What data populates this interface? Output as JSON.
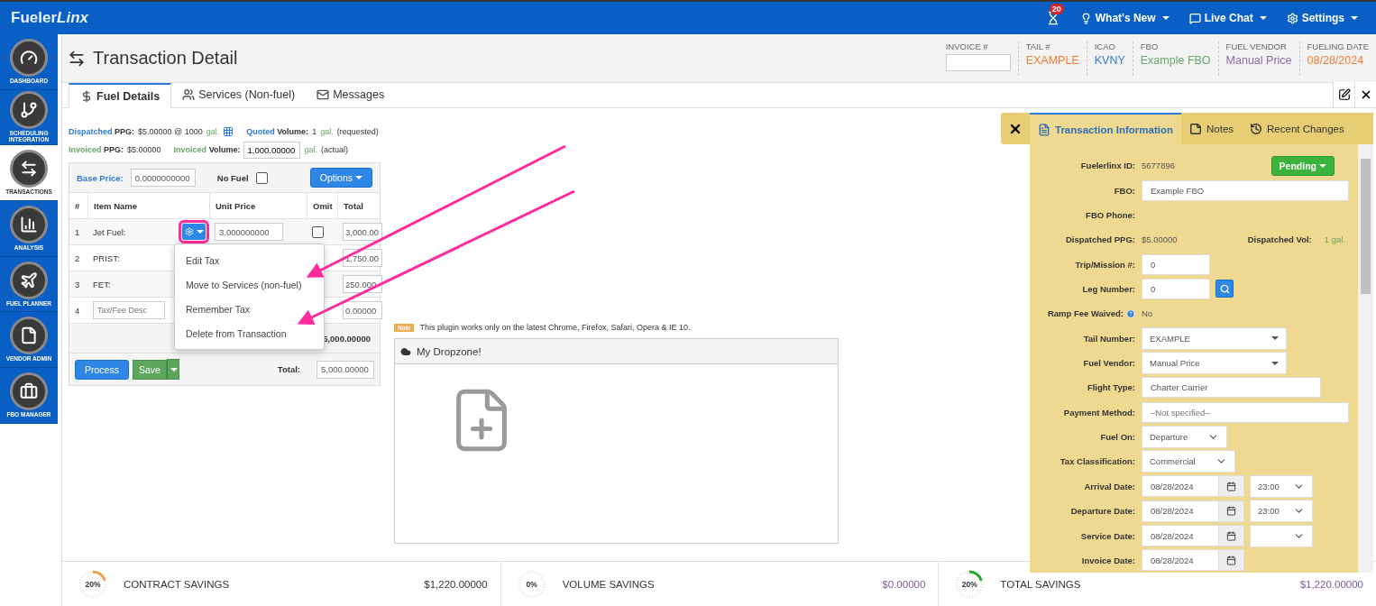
{
  "topbar": {
    "logo_main": "Fueler",
    "logo_accent": "Linx",
    "notification_count": "20",
    "menus": [
      {
        "kind": "bulb",
        "label": "What's New"
      },
      {
        "kind": "chat",
        "label": "Live Chat"
      },
      {
        "kind": "gear",
        "label": "Settings"
      }
    ]
  },
  "sidebar": [
    {
      "kind": "gauge",
      "label": "DASHBOARD",
      "selected": false
    },
    {
      "kind": "branch",
      "label": "SCHEDULING INTEGRATION",
      "selected": false
    },
    {
      "kind": "transfer",
      "label": "TRANSACTIONS",
      "selected": true
    },
    {
      "kind": "chart",
      "label": "ANALYSIS",
      "selected": false
    },
    {
      "kind": "plane",
      "label": "FUEL PLANNER",
      "selected": false
    },
    {
      "kind": "file",
      "label": "VENDOR ADMIN",
      "selected": false
    },
    {
      "kind": "briefcase",
      "label": "FBO MANAGER",
      "selected": false
    }
  ],
  "header": {
    "title": "Transaction Detail",
    "invoice_label": "INVOICE #",
    "summary": [
      {
        "label": "TAIL #",
        "value": "EXAMPLE",
        "color": "#f47c30"
      },
      {
        "label": "ICAO",
        "value": "KVNY",
        "color": "#2e7bd6"
      },
      {
        "label": "FBO",
        "value": "Example FBO",
        "color": "#6aa56a"
      },
      {
        "label": "FUEL VENDOR",
        "value": "Manual Price",
        "color": "#8a6aa5"
      },
      {
        "label": "FUELING DATE",
        "value": "08/28/2024",
        "color": "#f47c30"
      }
    ]
  },
  "tabs": [
    {
      "kind": "dollar",
      "label": "Fuel Details",
      "selected": true
    },
    {
      "kind": "users",
      "label": "Services (Non-fuel)",
      "selected": false
    },
    {
      "kind": "mail",
      "label": "Messages",
      "selected": false
    }
  ],
  "fuel_info": [
    [
      {
        "kind": "text",
        "accent": "Dispatched",
        "label": "PPG:",
        "value": "$5.00000 @ 1000",
        "unit": "gal.",
        "color": "#2e7bd6",
        "calculator": true
      },
      {
        "kind": "text",
        "accent": "Quoted",
        "label": "Volume:",
        "value": "1",
        "unit": "gal.",
        "suffix": "(requested)",
        "color": "#2e7bd6"
      }
    ],
    [
      {
        "kind": "text",
        "accent": "Invoiced",
        "label": "PPG:",
        "value": "$5.00000",
        "color": "#6aa56a"
      },
      {
        "kind": "input",
        "accent": "Invoiced",
        "label": "Volume:",
        "value": "1,000.00000",
        "unit": "gal.",
        "suffix": "(actual)",
        "color": "#6aa56a"
      }
    ]
  ],
  "table": {
    "base_price_label": "Base Price:",
    "base_price": "0.0000000000",
    "no_fuel_label": "No Fuel",
    "no_fuel_checked": false,
    "options": "Options",
    "columns": [
      "#",
      "Item Name",
      "Unit Price",
      "Omit",
      "Total"
    ],
    "rows": [
      {
        "kind": "fuel",
        "number": "1",
        "name": "Jet Fuel:",
        "unit_price": "3.000000000",
        "omit": false,
        "total": "3,000.00",
        "gear_highlighted": true
      },
      {
        "kind": "tax",
        "number": "2",
        "name": "PRIST:",
        "total": "1,750.00"
      },
      {
        "kind": "tax",
        "number": "3",
        "name": "FET:",
        "total": "250.000"
      },
      {
        "kind": "new",
        "number": "4",
        "placeholder": "Tax/Fee Desc",
        "total": "0.00000"
      }
    ],
    "subtotal": "5,000.00000",
    "process": "Process",
    "save": "Save",
    "total_label": "Total:",
    "total": "5,000.00000"
  },
  "gear_menu": [
    {
      "label": "Edit Tax",
      "pointed": false
    },
    {
      "label": "Move to Services (non-fuel)",
      "pointed": true
    },
    {
      "label": "Remember Tax",
      "pointed": false
    },
    {
      "label": "Delete from Transaction",
      "pointed": true
    }
  ],
  "dropzone": {
    "note_badge": "Note",
    "note": "This plugin works only on the latest Chrome, Firefox, Safari, Opera & IE 10.",
    "title": "My Dropzone!"
  },
  "panel": {
    "tabs": [
      {
        "kind": "doc",
        "label": "Transaction Information",
        "selected": true
      },
      {
        "kind": "note",
        "label": "Notes",
        "selected": false
      },
      {
        "kind": "history",
        "label": "Recent Changes",
        "selected": false
      }
    ],
    "fields": [
      {
        "kind": "id",
        "label": "Fuelerlinx ID:",
        "value": "5677896",
        "status": "Pending"
      },
      {
        "kind": "input",
        "label": "FBO:",
        "value": "Example FBO"
      },
      {
        "kind": "plain",
        "label": "FBO Phone:"
      },
      {
        "kind": "pair",
        "label": "Dispatched PPG:",
        "value": "$5.00000",
        "label_2": "Dispatched Vol:",
        "value_2": "1 gal."
      },
      {
        "kind": "short-input",
        "label": "Trip/Mission #:",
        "value": "0"
      },
      {
        "kind": "search-input",
        "label": "Leg Number:",
        "value": "0"
      },
      {
        "kind": "help",
        "label": "Ramp Fee Waived:",
        "value": "No"
      },
      {
        "kind": "select",
        "label": "Tail Number:",
        "value": "EXAMPLE"
      },
      {
        "kind": "select",
        "label": "Fuel Vendor:",
        "value": "Manual Price"
      },
      {
        "kind": "medium-input",
        "label": "Flight Type:",
        "value": "Charter Carrier"
      },
      {
        "kind": "input",
        "label": "Payment Method:",
        "placeholder": "–Not specified–"
      },
      {
        "kind": "dropdown",
        "label": "Fuel On:",
        "value": "Departure"
      },
      {
        "kind": "dropdown",
        "label": "Tax Classification:",
        "value": "Commercial"
      },
      {
        "kind": "date-time",
        "label": "Arrival Date:",
        "value": "08/28/2024",
        "time": "23:00"
      },
      {
        "kind": "date-time",
        "label": "Departure Date:",
        "value": "08/28/2024",
        "time": "23:00"
      },
      {
        "kind": "date-time",
        "label": "Service Date:",
        "value": "08/28/2024"
      },
      {
        "kind": "date",
        "label": "Invoice Date:",
        "value": "08/28/2024"
      }
    ]
  },
  "savings": [
    {
      "percent": "20%",
      "label": "CONTRACT SAVINGS",
      "value": "$1,220.00000",
      "level": 0.2,
      "color": "#f0a050"
    },
    {
      "percent": "0%",
      "label": "VOLUME SAVINGS",
      "value": "$0.00000",
      "level": 0
    },
    {
      "percent": "20%",
      "label": "TOTAL SAVINGS",
      "value": "$1,220.00000",
      "level": 0.2,
      "color": "#22aa22"
    }
  ]
}
